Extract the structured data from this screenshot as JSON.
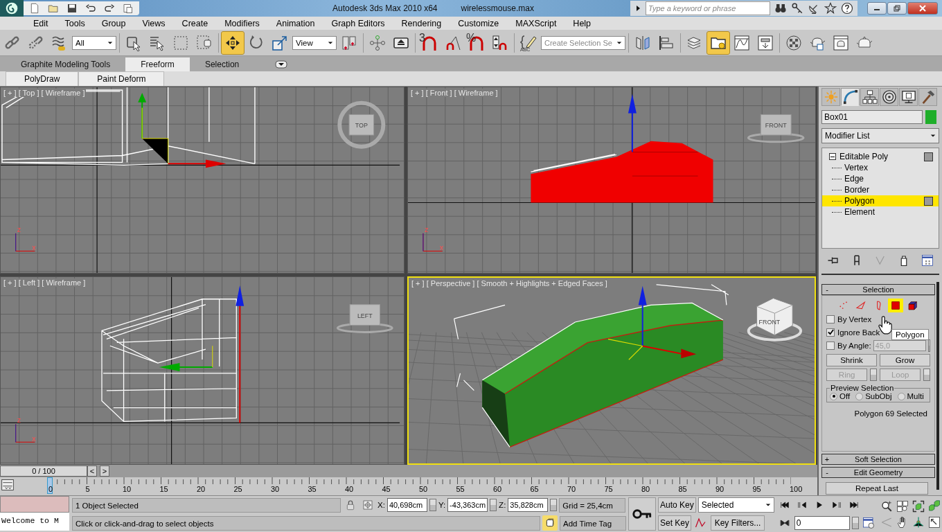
{
  "title_bar": {
    "title": "Autodesk 3ds Max  2010 x64",
    "file_name": "wirelessmouse.max",
    "search": {
      "placeholder": "Type a keyword or phrase"
    }
  },
  "menu": [
    "Edit",
    "Tools",
    "Group",
    "Views",
    "Create",
    "Modifiers",
    "Animation",
    "Graph Editors",
    "Rendering",
    "Customize",
    "MAXScript",
    "Help"
  ],
  "toolbar": [
    {
      "kind": "link",
      "selected": false
    },
    {
      "kind": "unlink",
      "selected": false
    },
    {
      "kind": "bind",
      "selected": false
    },
    {
      "kind": "dropdown",
      "value": "All"
    },
    {
      "kind": "select",
      "selected": false
    },
    {
      "kind": "select_name",
      "selected": false
    },
    {
      "kind": "region",
      "selected": false
    },
    {
      "kind": "crossing",
      "selected": false
    },
    {
      "kind": "move",
      "selected": true
    },
    {
      "kind": "rotate",
      "selected": false
    },
    {
      "kind": "scale",
      "selected": false
    },
    {
      "kind": "dropdown",
      "value": "View"
    },
    {
      "kind": "pivot",
      "selected": false
    },
    {
      "kind": "manipulate",
      "selected": false
    },
    {
      "kind": "keyboard",
      "selected": false
    },
    {
      "kind": "snap",
      "selected": false,
      "label": "3"
    },
    {
      "kind": "angle_snap",
      "selected": false
    },
    {
      "kind": "percent_snap",
      "selected": false,
      "label": "%"
    },
    {
      "kind": "spinner_snap",
      "selected": false
    },
    {
      "kind": "named_sets",
      "selected": false,
      "label": "ABC"
    },
    {
      "kind": "dropdown",
      "value": "Create Selection Se"
    },
    {
      "kind": "mirror",
      "selected": false
    },
    {
      "kind": "align",
      "selected": false
    },
    {
      "kind": "layers",
      "selected": false
    },
    {
      "kind": "explorer",
      "selected": true
    },
    {
      "kind": "curve",
      "selected": false
    },
    {
      "kind": "schematic",
      "selected": false
    },
    {
      "kind": "material",
      "selected": false
    },
    {
      "kind": "render_setup",
      "selected": false
    },
    {
      "kind": "frame_window",
      "selected": false
    },
    {
      "kind": "render",
      "selected": false
    }
  ],
  "ribbon": {
    "tabs": [
      {
        "label": "Graphite Modeling Tools",
        "selected": false
      },
      {
        "label": "Freeform",
        "selected": true
      },
      {
        "label": "Selection",
        "selected": false
      }
    ],
    "panels": [
      "PolyDraw",
      "Paint Deform"
    ]
  },
  "viewports": [
    {
      "kind": "top",
      "label": "[ + ] [ Top ] [ Wireframe ]",
      "active": false,
      "cube_label": "TOP",
      "axes": [
        "z",
        "x"
      ]
    },
    {
      "kind": "front",
      "label": "[ + ] [ Front ] [ Wireframe ]",
      "active": false,
      "cube_label": "FRONT",
      "axes": [
        "z",
        "x"
      ]
    },
    {
      "kind": "left",
      "label": "[ + ] [ Left ] [ Wireframe ]",
      "active": false,
      "cube_label": "LEFT",
      "axes": [
        "z",
        "x"
      ]
    },
    {
      "kind": "perspective",
      "label": "[ + ] [ Perspective ] [ Smooth + Highlights + Edged Faces ]",
      "active": true,
      "cube_label": "FRONT"
    }
  ],
  "time_slider": {
    "label": "0 / 100",
    "prev": "<",
    "next": ">"
  },
  "track_bar": {
    "ticks": [
      "0",
      "5",
      "10",
      "15",
      "20",
      "25",
      "30",
      "35",
      "40",
      "45",
      "50",
      "55",
      "60",
      "65",
      "70",
      "75",
      "80",
      "85",
      "90",
      "95",
      "100"
    ]
  },
  "command_panel": {
    "tabs": [
      {
        "kind": "create",
        "selected": false
      },
      {
        "kind": "modify",
        "selected": true
      },
      {
        "kind": "hierarchy",
        "selected": false
      },
      {
        "kind": "motion",
        "selected": false
      },
      {
        "kind": "display",
        "selected": false
      },
      {
        "kind": "utilities",
        "selected": false
      }
    ],
    "object_name": "Box01",
    "modifier_list": "Modifier List",
    "stack": [
      {
        "label": "Editable Poly",
        "expanded": true,
        "selected": false,
        "children": [
          {
            "label": "Vertex",
            "selected": false
          },
          {
            "label": "Edge",
            "selected": false
          },
          {
            "label": "Border",
            "selected": false
          },
          {
            "label": "Polygon",
            "selected": true
          },
          {
            "label": "Element",
            "selected": false
          }
        ]
      }
    ],
    "selection": {
      "sign": "-",
      "title": "Selection",
      "levels": [
        {
          "kind": "vertex",
          "selected": false
        },
        {
          "kind": "edge",
          "selected": false
        },
        {
          "kind": "border",
          "selected": false
        },
        {
          "kind": "polygon",
          "selected": true
        },
        {
          "kind": "element",
          "selected": false
        }
      ],
      "tooltip": "Polygon",
      "checks": [
        {
          "label": "By Vertex",
          "checked": false
        },
        {
          "label": "Ignore Back",
          "checked": true
        }
      ],
      "angle": {
        "label": "By Angle:",
        "checked": false,
        "value": "45,0"
      },
      "buttons": [
        {
          "label": "Shrink",
          "disabled": false
        },
        {
          "label": "Grow",
          "disabled": false
        }
      ],
      "spinner_buttons": [
        {
          "label": "Ring",
          "disabled": true
        },
        {
          "label": "Loop",
          "disabled": true
        }
      ],
      "preview": {
        "title": "Preview Selection",
        "options": [
          {
            "label": "Off",
            "selected": true
          },
          {
            "label": "SubObj",
            "selected": false
          },
          {
            "label": "Multi",
            "selected": false
          }
        ]
      },
      "summary": "Polygon 69 Selected"
    },
    "rollouts": [
      {
        "sign": "+",
        "title": "Soft Selection"
      },
      {
        "sign": "-",
        "title": "Edit Geometry"
      }
    ],
    "repeat_button": "Repeat Last"
  },
  "status_bar": {
    "listener": "Welcome to M",
    "prompt": "1 Object Selected",
    "hint": "Click or click-and-drag to select objects",
    "coords": [
      {
        "axis": "X:",
        "value": "40,698cm"
      },
      {
        "axis": "Y:",
        "value": "-43,363cm"
      },
      {
        "axis": "Z:",
        "value": "35,828cm"
      }
    ],
    "grid": "Grid = 25,4cm",
    "time_tag": "Add Time Tag",
    "auto_key": "Auto Key",
    "set_key": "Set Key",
    "key_set": "Selected",
    "key_filters": "Key Filters...",
    "frame": "0"
  }
}
